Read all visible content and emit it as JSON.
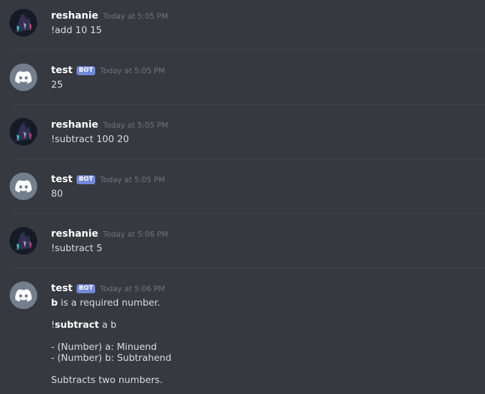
{
  "messages": [
    {
      "author": "reshanie",
      "bot": false,
      "time": "Today at 5:05 PM",
      "text": "!add 10 15"
    },
    {
      "author": "test",
      "bot": true,
      "bot_tag": "BOT",
      "time": "Today at 5:05 PM",
      "text": "25"
    },
    {
      "author": "reshanie",
      "bot": false,
      "time": "Today at 5:05 PM",
      "text": "!subtract 100 20"
    },
    {
      "author": "test",
      "bot": true,
      "bot_tag": "BOT",
      "time": "Today at 5:05 PM",
      "text": "80"
    },
    {
      "author": "reshanie",
      "bot": false,
      "time": "Today at 5:06 PM",
      "text": "!subtract 5"
    },
    {
      "author": "test",
      "bot": true,
      "bot_tag": "BOT",
      "time": "Today at 5:06 PM",
      "error": {
        "param": "b",
        "required_text": " is a required number.",
        "prefix": "!",
        "command": "subtract",
        "args": " a b",
        "param_a": "- (Number) a: Minuend",
        "param_b": "- (Number) b: Subtrahend",
        "description": "Subtracts two numbers."
      }
    }
  ],
  "icons": {
    "bot_avatar": "discord-logo-icon",
    "user_avatar": "user-avatar"
  }
}
